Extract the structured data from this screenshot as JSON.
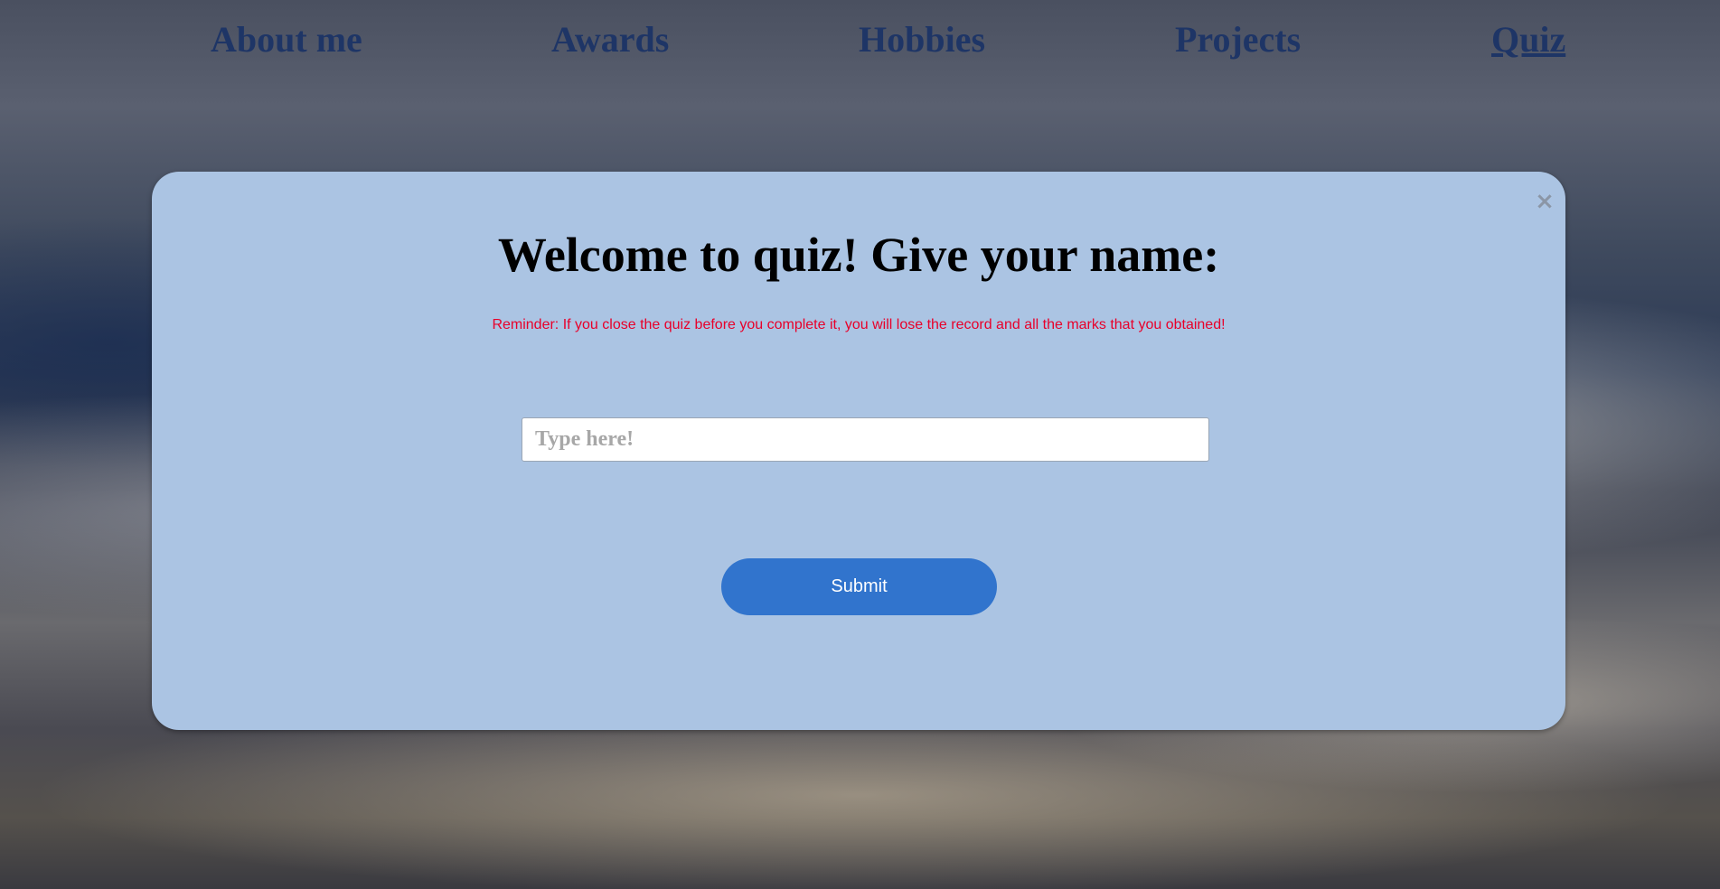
{
  "nav": {
    "items": [
      {
        "label": "About me"
      },
      {
        "label": "Awards"
      },
      {
        "label": "Hobbies"
      },
      {
        "label": "Projects"
      },
      {
        "label": "Quiz",
        "active": true
      }
    ]
  },
  "modal": {
    "close_symbol": "×",
    "title": "Welcome to quiz! Give your name:",
    "reminder": "Reminder: If you close the quiz before you complete it, you will lose the record and all the marks that you obtained!",
    "name_input": {
      "value": "",
      "placeholder": "Type here!"
    },
    "submit_label": "Submit"
  },
  "colors": {
    "nav_link": "#1e3566",
    "modal_background": "#abc4e3",
    "reminder_text": "#e8002a",
    "submit_button": "#3174cd"
  },
  "icons": {
    "close": "close-icon"
  }
}
